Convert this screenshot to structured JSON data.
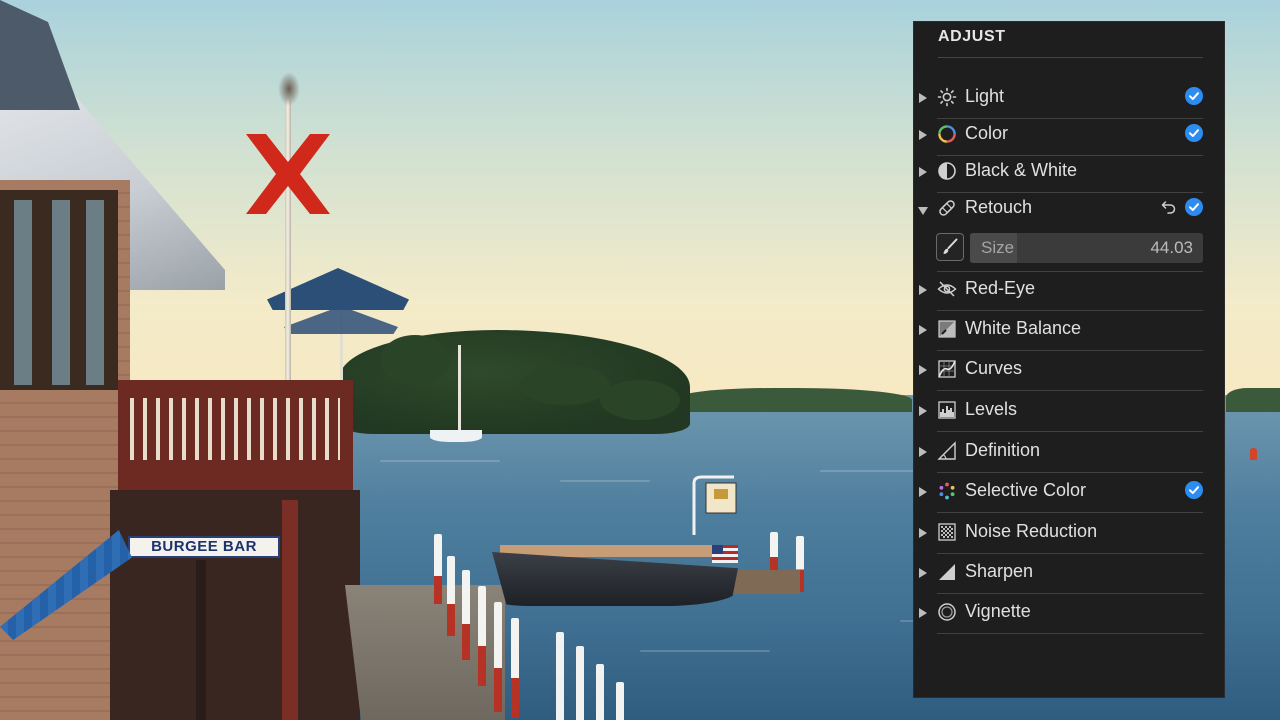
{
  "photo": {
    "sign_text": "BURGEE BAR"
  },
  "panel": {
    "title": "ADJUST",
    "items": [
      {
        "label": "Light",
        "icon": "sun-icon",
        "checked": true,
        "expanded": false
      },
      {
        "label": "Color",
        "icon": "color-wheel-icon",
        "checked": true,
        "expanded": false
      },
      {
        "label": "Black & White",
        "icon": "half-circle-icon",
        "checked": false,
        "expanded": false
      },
      {
        "label": "Retouch",
        "icon": "bandage-icon",
        "checked": true,
        "expanded": true
      },
      {
        "label": "Red-Eye",
        "icon": "eye-slash-icon",
        "checked": false,
        "expanded": false
      },
      {
        "label": "White Balance",
        "icon": "white-balance-icon",
        "checked": false,
        "expanded": false
      },
      {
        "label": "Curves",
        "icon": "curves-icon",
        "checked": false,
        "expanded": false
      },
      {
        "label": "Levels",
        "icon": "levels-icon",
        "checked": false,
        "expanded": false
      },
      {
        "label": "Definition",
        "icon": "definition-icon",
        "checked": false,
        "expanded": false
      },
      {
        "label": "Selective Color",
        "icon": "selective-color-icon",
        "checked": true,
        "expanded": false
      },
      {
        "label": "Noise Reduction",
        "icon": "noise-icon",
        "checked": false,
        "expanded": false
      },
      {
        "label": "Sharpen",
        "icon": "sharpen-icon",
        "checked": false,
        "expanded": false
      },
      {
        "label": "Vignette",
        "icon": "vignette-icon",
        "checked": false,
        "expanded": false
      }
    ],
    "retouch": {
      "size_label": "Size",
      "size_value": "44.03",
      "size_fraction": 0.2
    },
    "colors": {
      "accent": "#2d8cf0",
      "panel_bg": "#1e1e1e",
      "overlay_x": "#d0281b"
    }
  }
}
